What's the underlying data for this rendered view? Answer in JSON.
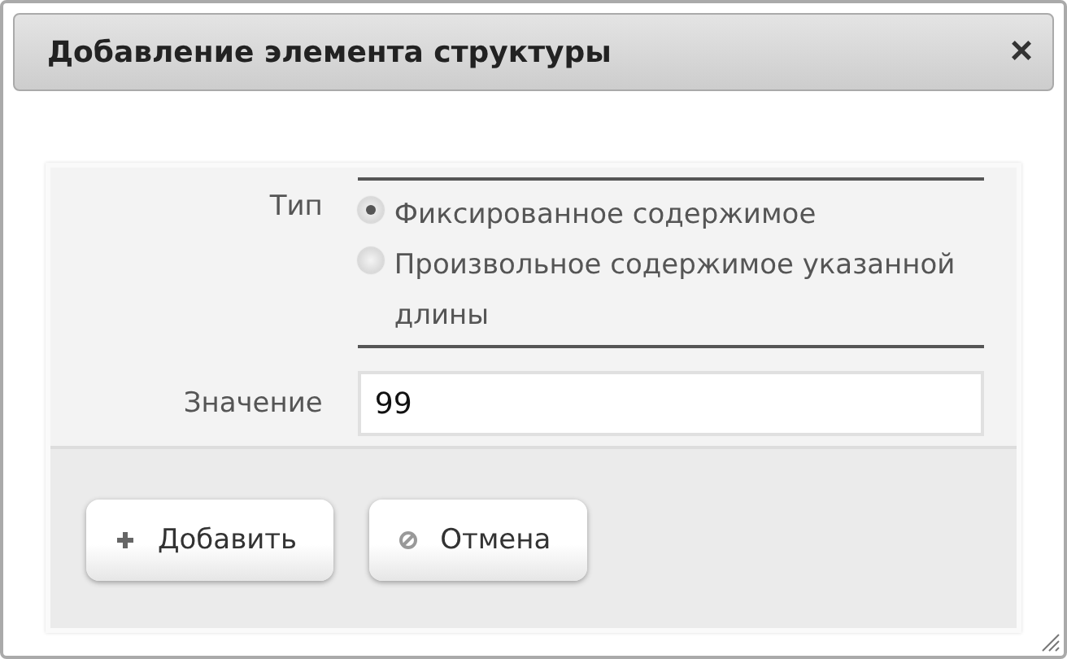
{
  "dialog": {
    "title": "Добавление элемента структуры",
    "close": "×"
  },
  "form": {
    "type_label": "Тип",
    "options": [
      {
        "label": "Фиксированное содержимое",
        "selected": true
      },
      {
        "label": "Произвольное содержимое указанной длины",
        "selected": false
      }
    ],
    "value_label": "Значение",
    "value": "99"
  },
  "buttons": [
    {
      "kind": "add",
      "label": "Добавить"
    },
    {
      "kind": "cancel",
      "label": "Отмена"
    }
  ]
}
